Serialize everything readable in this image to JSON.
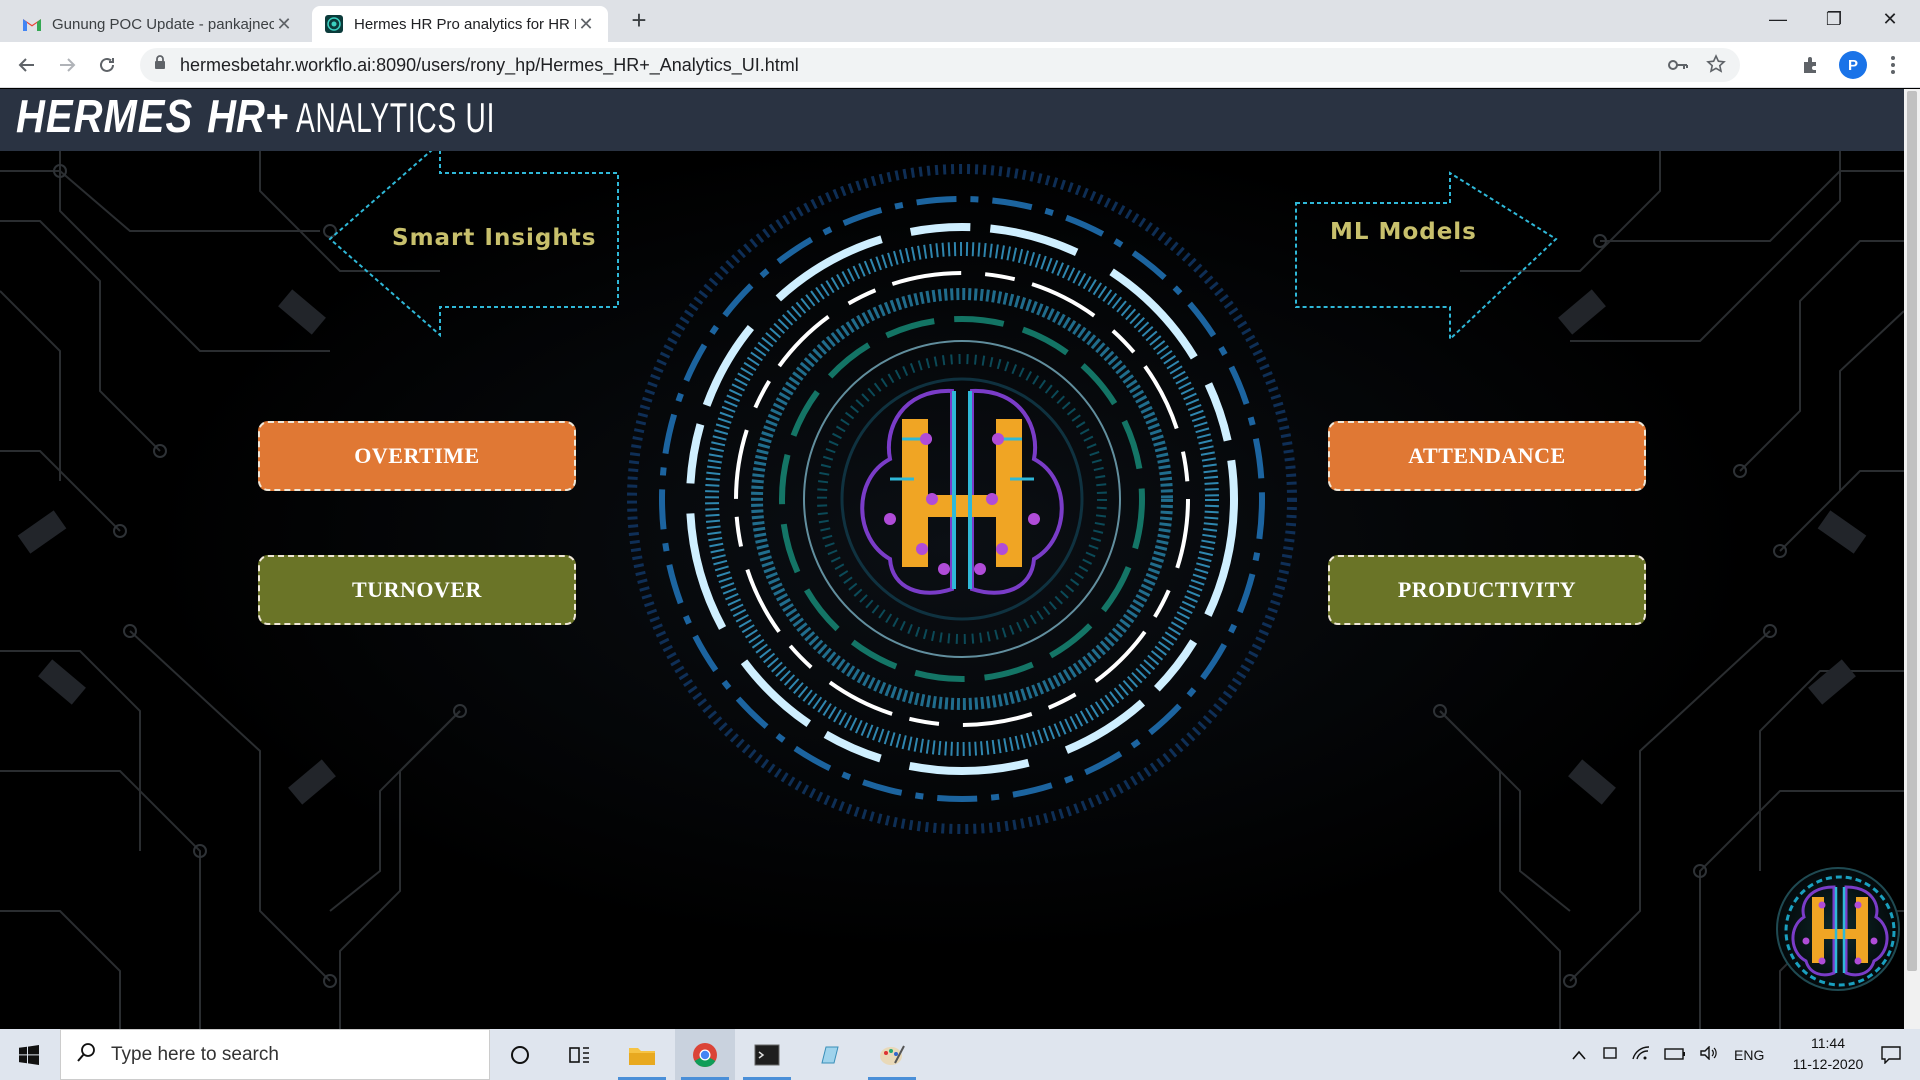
{
  "browser": {
    "tabs": [
      {
        "title": "Gunung POC Update - pankajnec",
        "favicon": "gmail-icon"
      },
      {
        "title": "Hermes HR Pro analytics for HR F",
        "favicon": "hermes-icon"
      }
    ],
    "new_tab": "+",
    "window_controls": {
      "minimize": "—",
      "maximize": "❐",
      "close": "✕"
    },
    "url": "hermesbetahr.workflo.ai:8090/users/rony_hp/Hermes_HR+_Analytics_UI.html",
    "profile_initial": "P"
  },
  "app": {
    "brand": {
      "part1": "HERMES",
      "part2": "HR+",
      "part3": "ANALYTICS  UI"
    },
    "smart_insights_label": "Smart Insights",
    "ml_models_label": "ML Models",
    "buttons": {
      "overtime": "OVERTIME",
      "turnover": "TURNOVER",
      "attendance": "ATTENDANCE",
      "productivity": "PRODUCTIVITY"
    },
    "colors": {
      "orange": "#e07834",
      "green": "#6a7427",
      "accent_cyan": "#2fb8d8",
      "label_gold": "#c8c06c"
    }
  },
  "taskbar": {
    "search_placeholder": "Type here to search",
    "language": "ENG",
    "time": "11:44",
    "date": "11-12-2020"
  }
}
